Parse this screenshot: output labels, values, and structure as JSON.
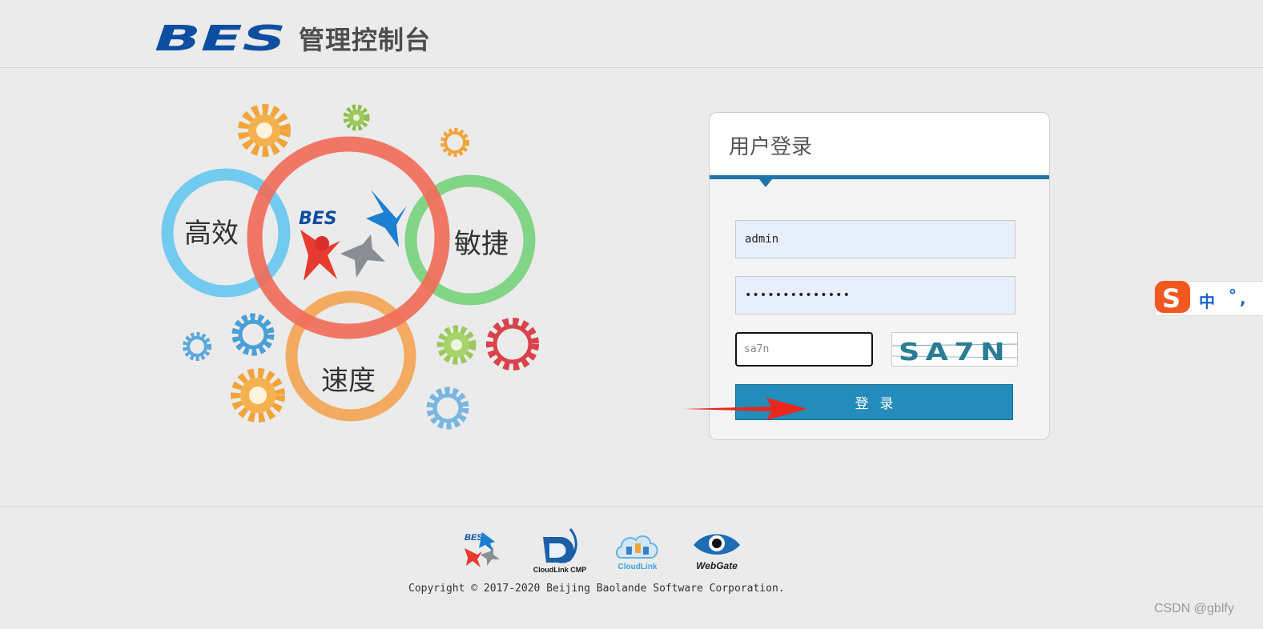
{
  "header": {
    "logo_text": "BES",
    "title": "管理控制台"
  },
  "hero": {
    "circle_labels": {
      "efficient": "高效",
      "agile": "敏捷",
      "speed": "速度"
    },
    "center_logo_text": "BES",
    "colors": {
      "blue_ring": "#6cc8ee",
      "red_ring": "#f06c5a",
      "green_ring": "#77d17b",
      "orange_ring": "#f2a85a"
    }
  },
  "login": {
    "title": "用户登录",
    "username_value": "admin",
    "password_value": "••••••••••••••",
    "captcha_placeholder": "sa7n",
    "captcha_image_text": "SA7N",
    "submit_label": "登录",
    "accent_color": "#1f74a8",
    "button_color": "#238cba"
  },
  "ime": {
    "mode_label": "中",
    "punct_dot": "°",
    "punct_comma": ","
  },
  "footer": {
    "logos": [
      {
        "name": "BES",
        "label": ""
      },
      {
        "name": "CloudLink CMP",
        "label": "CloudLink CMP"
      },
      {
        "name": "CloudLink",
        "label": "CloudLink"
      },
      {
        "name": "WebGate",
        "label": "WebGate"
      }
    ],
    "copyright": "Copyright © 2017-2020 Beijing Baolande Software Corporation."
  },
  "watermark": "CSDN @gblfy"
}
